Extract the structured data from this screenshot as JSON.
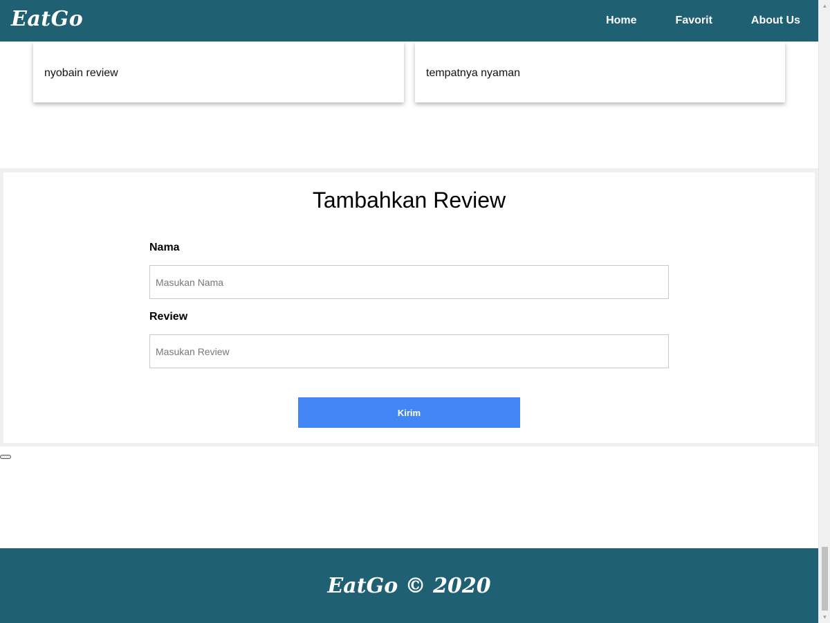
{
  "header": {
    "brand": "EatGo",
    "nav": [
      {
        "label": "Home"
      },
      {
        "label": "Favorit"
      },
      {
        "label": "About Us"
      }
    ]
  },
  "reviews": [
    {
      "text": "nyobain review"
    },
    {
      "text": "tempatnya nyaman"
    }
  ],
  "form": {
    "title": "Tambahkan Review",
    "name_label": "Nama",
    "name_placeholder": "Masukan Nama",
    "name_value": "",
    "review_label": "Review",
    "review_placeholder": "Masukan Review",
    "review_value": "",
    "submit_label": "Kirim"
  },
  "footer": {
    "text": "EatGo © 2020"
  },
  "colors": {
    "primary": "#1f6073",
    "button": "#4285f4"
  }
}
